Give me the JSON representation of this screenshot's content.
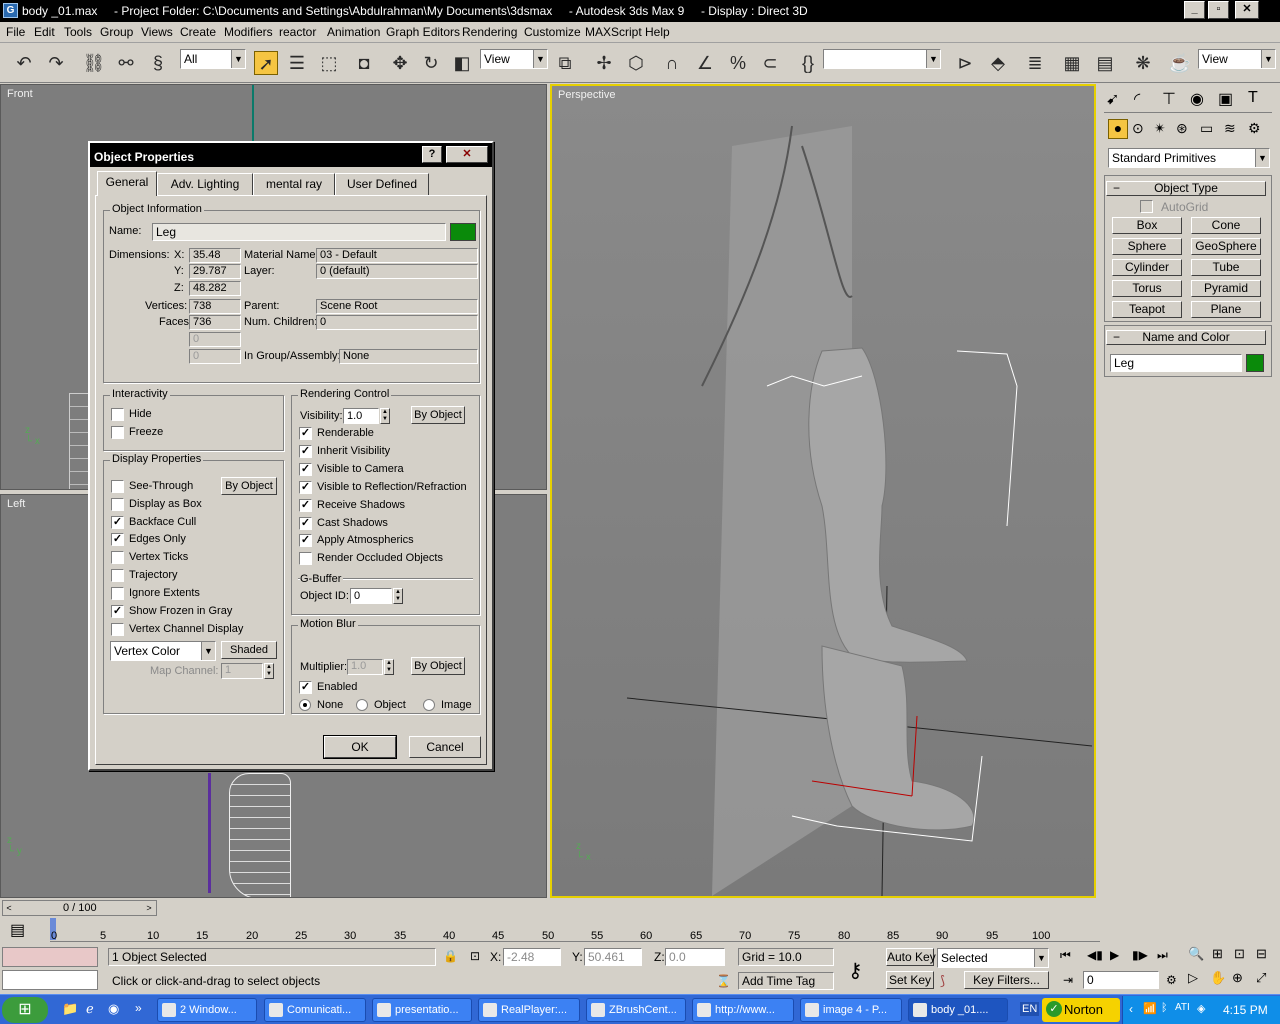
{
  "window": {
    "title": "body _01.max     - Project Folder: C:\\Documents and Settings\\Abdulrahman\\My Documents\\3dsmax     - Autodesk 3ds Max 9     - Display : Direct 3D",
    "icon_letter": "G"
  },
  "menu": [
    "File",
    "Edit",
    "Tools",
    "Group",
    "Views",
    "Create",
    "Modifiers",
    "reactor",
    "Animation",
    "Graph Editors",
    "Rendering",
    "Customize",
    "MAXScript",
    "Help"
  ],
  "toolbar": {
    "filter_value": "All",
    "ref_coord": "View",
    "named_sel": "",
    "view_right": "View"
  },
  "viewports": {
    "front": "Front",
    "left": "Left",
    "perspective": "Perspective"
  },
  "dialog": {
    "title": "Object Properties",
    "help_btn": "?",
    "close_btn": "✕",
    "tabs": [
      "General",
      "Adv. Lighting",
      "mental ray",
      "User Defined"
    ],
    "object_info": {
      "group_title": "Object Information",
      "name_label": "Name:",
      "name_value": "Leg",
      "color": "#0a8a0a",
      "dim_label": "Dimensions:",
      "x_label": "X:",
      "x": "35.48",
      "y_label": "Y:",
      "y": "29.787",
      "z_label": "Z:",
      "z": "48.282",
      "material_label": "Material Name:",
      "material": "03 - Default",
      "layer_label": "Layer:",
      "layer": "0 (default)",
      "vertices_label": "Vertices:",
      "vertices": "738",
      "faces_label": "Faces:",
      "faces": "736",
      "parent_label": "Parent:",
      "parent": "Scene Root",
      "children_label": "Num. Children:",
      "children": "0",
      "extra1": "0",
      "extra2": "0",
      "group_label": "In Group/Assembly:",
      "group_value": "None"
    },
    "interactivity": {
      "title": "Interactivity",
      "hide": "Hide",
      "freeze": "Freeze"
    },
    "display": {
      "title": "Display Properties",
      "by_object": "By Object",
      "items": [
        {
          "label": "See-Through",
          "checked": false
        },
        {
          "label": "Display as Box",
          "checked": false
        },
        {
          "label": "Backface Cull",
          "checked": true
        },
        {
          "label": "Edges Only",
          "checked": true
        },
        {
          "label": "Vertex Ticks",
          "checked": false
        },
        {
          "label": "Trajectory",
          "checked": false
        },
        {
          "label": "Ignore Extents",
          "checked": false
        },
        {
          "label": "Show Frozen in Gray",
          "checked": true
        },
        {
          "label": "Vertex Channel Display",
          "checked": false
        }
      ],
      "vertex_color": "Vertex Color",
      "shaded": "Shaded",
      "map_channel_label": "Map Channel:",
      "map_channel": "1"
    },
    "rendering": {
      "title": "Rendering Control",
      "visibility_label": "Visibility:",
      "visibility": "1.0",
      "by_object": "By Object",
      "items": [
        {
          "label": "Renderable",
          "checked": true
        },
        {
          "label": "Inherit Visibility",
          "checked": true
        },
        {
          "label": "Visible to Camera",
          "checked": true
        },
        {
          "label": "Visible to Reflection/Refraction",
          "checked": true
        },
        {
          "label": "Receive Shadows",
          "checked": true
        },
        {
          "label": "Cast Shadows",
          "checked": true
        },
        {
          "label": "Apply Atmospherics",
          "checked": true
        },
        {
          "label": "Render Occluded Objects",
          "checked": false
        }
      ],
      "gbuffer_title": "G-Buffer",
      "object_id_label": "Object ID:",
      "object_id": "0"
    },
    "motion_blur": {
      "title": "Motion Blur",
      "multiplier_label": "Multiplier:",
      "multiplier": "1.0",
      "by_object": "By Object",
      "enabled": "Enabled",
      "none": "None",
      "object": "Object",
      "image": "Image"
    },
    "ok": "OK",
    "cancel": "Cancel"
  },
  "command_panel": {
    "category": "Standard Primitives",
    "object_type": "Object Type",
    "autogrid": "AutoGrid",
    "buttons": [
      "Box",
      "Cone",
      "Sphere",
      "GeoSphere",
      "Cylinder",
      "Tube",
      "Torus",
      "Pyramid",
      "Teapot",
      "Plane"
    ],
    "name_and_color": "Name and Color",
    "name_value": "Leg",
    "color": "#0a8a0a"
  },
  "timeline": {
    "slider": "0 / 100",
    "ticks": [
      "0",
      "5",
      "10",
      "15",
      "20",
      "25",
      "30",
      "35",
      "40",
      "45",
      "50",
      "55",
      "60",
      "65",
      "70",
      "75",
      "80",
      "85",
      "90",
      "95",
      "100"
    ]
  },
  "status": {
    "selected": "1 Object Selected",
    "prompt": "Click or click-and-drag to select objects",
    "x_label": "X:",
    "x": "-2.48",
    "y_label": "Y:",
    "y": "50.461",
    "z_label": "Z:",
    "z": "0.0",
    "grid": "Grid = 10.0",
    "add_time_tag": "Add Time Tag",
    "auto_key": "Auto Key",
    "set_key": "Set Key",
    "key_mode": "Selected",
    "key_filters": "Key Filters...",
    "frame": "0"
  },
  "taskbar": {
    "items": [
      "2 Window...",
      "Comunicati...",
      "presentatio...",
      "RealPlayer:...",
      "ZBrushCent...",
      "http://www...",
      "image 4 - P...",
      "body _01...."
    ],
    "lang": "EN",
    "norton": "Norton",
    "clock": "4:15 PM"
  }
}
